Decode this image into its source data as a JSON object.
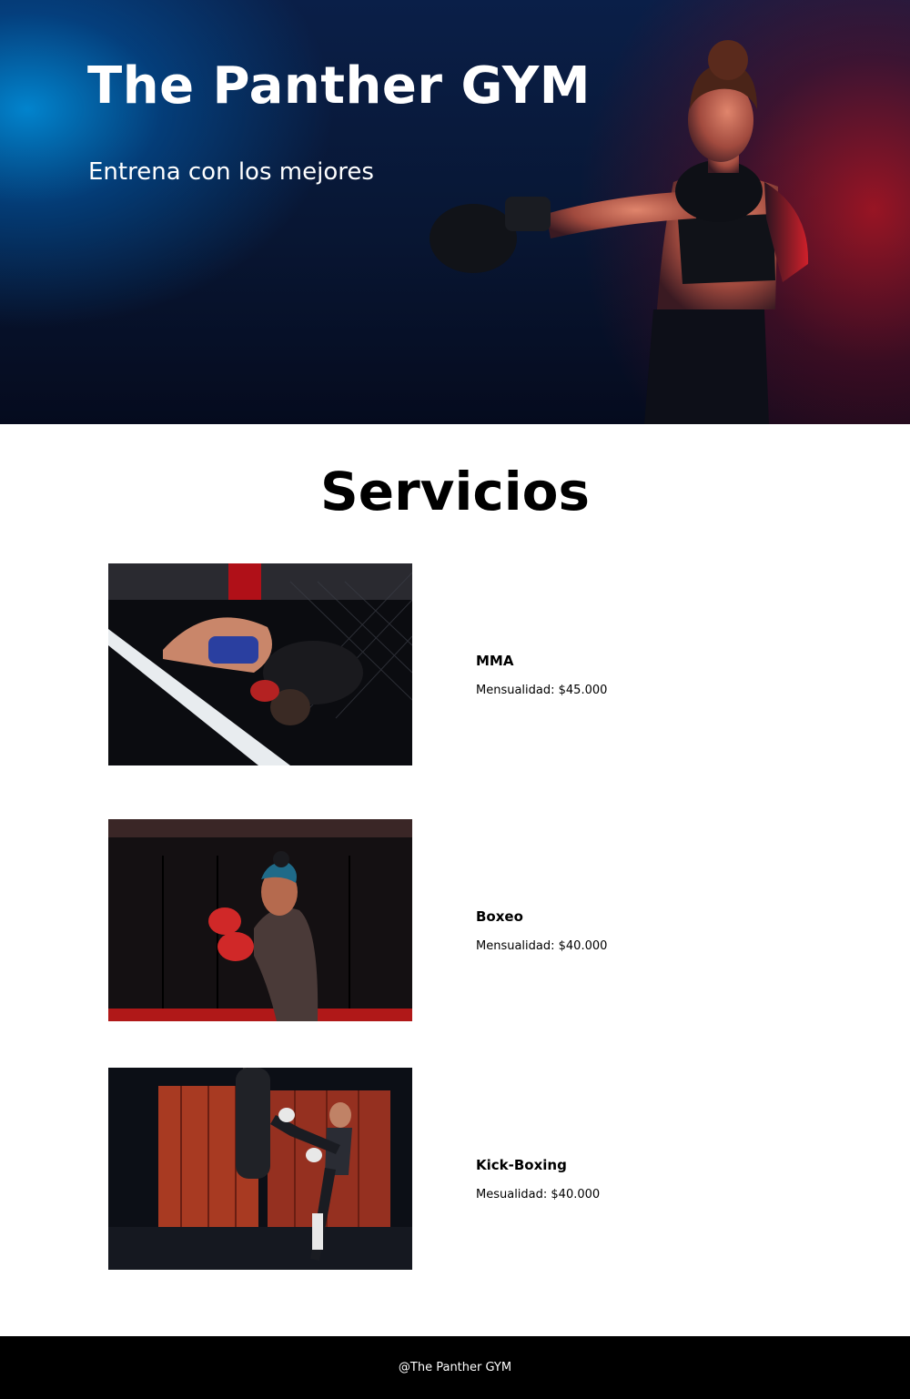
{
  "hero": {
    "title": "The Panther GYM",
    "subtitle": "Entrena con los mejores",
    "image_icon": "boxer-photo",
    "colors": {
      "blue_glow": "#0096e6",
      "red_glow": "#c8141e",
      "base": "#0a1f48"
    }
  },
  "services": {
    "title": "Servicios",
    "items": [
      {
        "name": "MMA",
        "price": "Mensualidad: $45.000",
        "image": "mma-fight-photo"
      },
      {
        "name": "Boxeo",
        "price": "Mensualidad: $40.000",
        "image": "boxing-photo"
      },
      {
        "name": "Kick-Boxing",
        "price": "Mesualidad: $40.000",
        "image": "kickboxing-photo"
      }
    ]
  },
  "footer": {
    "text": "@The Panther GYM",
    "background": "#000000"
  }
}
